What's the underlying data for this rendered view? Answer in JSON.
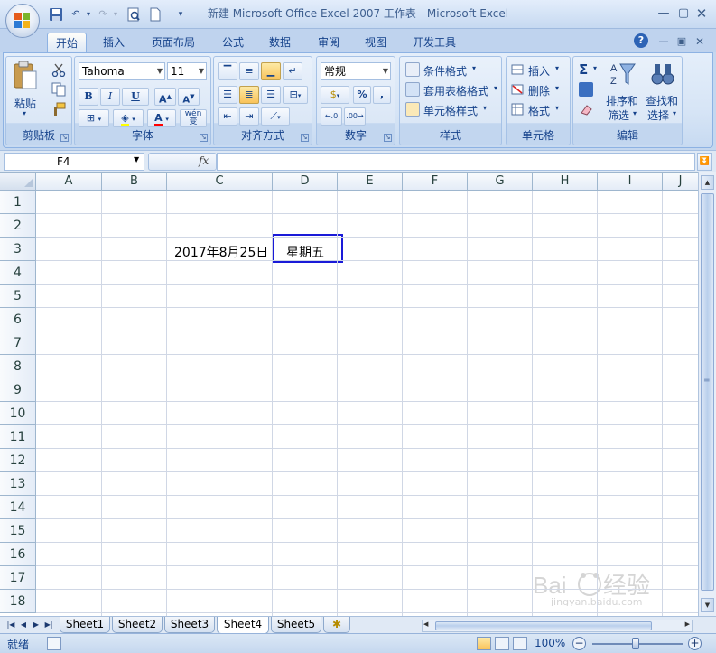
{
  "window": {
    "title": "新建 Microsoft Office Excel 2007 工作表 - Microsoft Excel"
  },
  "ribbon": {
    "tabs": [
      "开始",
      "插入",
      "页面布局",
      "公式",
      "数据",
      "审阅",
      "视图",
      "开发工具"
    ],
    "active_tab": "开始",
    "clipboard": {
      "label": "剪贴板",
      "paste": "粘贴"
    },
    "font": {
      "label": "字体",
      "name": "Tahoma",
      "size": "11",
      "bold": "B",
      "italic": "I",
      "underline": "U",
      "phonetic": "wén 变"
    },
    "alignment": {
      "label": "对齐方式"
    },
    "number": {
      "label": "数字",
      "format": "常规",
      "percent": "%",
      "comma": ","
    },
    "styles": {
      "label": "样式",
      "conditional": "条件格式",
      "table": "套用表格格式",
      "cell_styles": "单元格样式"
    },
    "cells": {
      "label": "单元格",
      "insert": "插入",
      "delete": "删除",
      "format": "格式"
    },
    "editing": {
      "label": "编辑",
      "sum": "Σ",
      "sort_filter_1": "排序和",
      "sort_filter_2": "筛选",
      "find_select_1": "查找和",
      "find_select_2": "选择"
    }
  },
  "formula_bar": {
    "name_box": "F4",
    "fx": "fx",
    "content": ""
  },
  "grid": {
    "columns": [
      "A",
      "B",
      "C",
      "D",
      "E",
      "F",
      "G",
      "H",
      "I",
      "J"
    ],
    "rows": [
      "1",
      "2",
      "3",
      "4",
      "5",
      "6",
      "7",
      "8",
      "9",
      "10",
      "11",
      "12",
      "13",
      "14",
      "15",
      "16",
      "17",
      "18"
    ],
    "cells": {
      "C3": "2017年8月25日",
      "D3": "星期五"
    }
  },
  "sheets": [
    "Sheet1",
    "Sheet2",
    "Sheet3",
    "Sheet4",
    "Sheet5"
  ],
  "active_sheet": "Sheet4",
  "status": {
    "ready": "就绪",
    "zoom": "100%"
  },
  "watermark": "Baidu经验 jingyan.baidu.com"
}
